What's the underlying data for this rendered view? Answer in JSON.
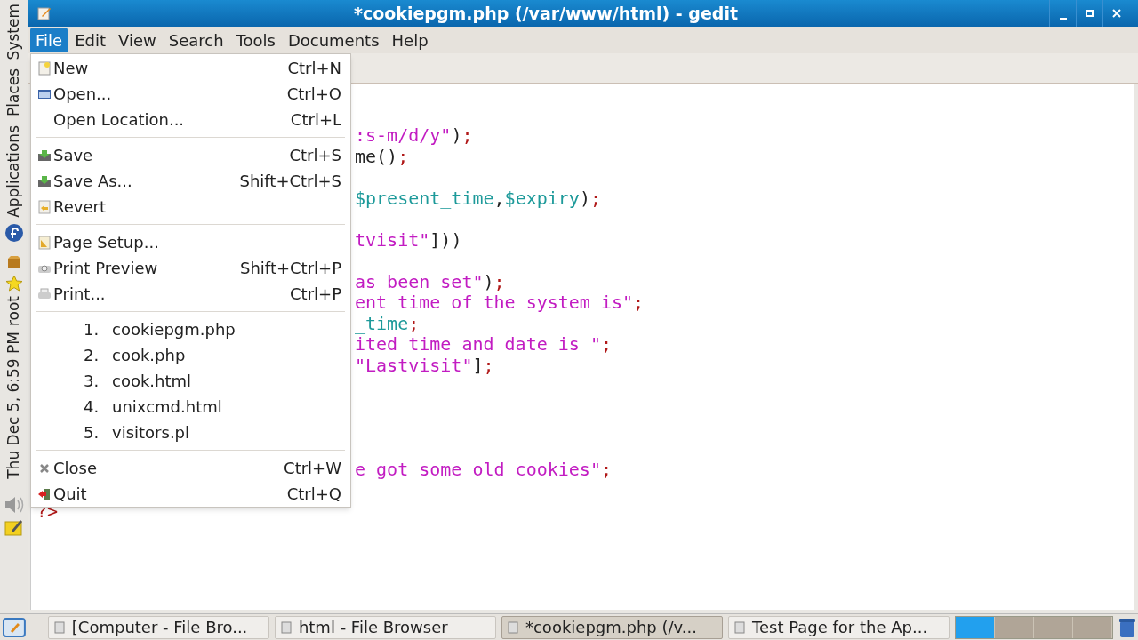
{
  "window": {
    "title": "*cookiepgm.php (/var/www/html) - gedit"
  },
  "side_panel": {
    "menus": [
      "System",
      "Places",
      "Applications"
    ],
    "user": "root",
    "clock": "Thu Dec  5,  6:59 PM"
  },
  "menubar": [
    {
      "label": "File",
      "selected": true
    },
    {
      "label": "Edit",
      "selected": false
    },
    {
      "label": "View",
      "selected": false
    },
    {
      "label": "Search",
      "selected": false
    },
    {
      "label": "Tools",
      "selected": false
    },
    {
      "label": "Documents",
      "selected": false
    },
    {
      "label": "Help",
      "selected": false
    }
  ],
  "file_menu": {
    "sections": [
      [
        {
          "kind": "action",
          "label": "New",
          "shortcut": "Ctrl+N"
        },
        {
          "kind": "action",
          "label": "Open...",
          "shortcut": "Ctrl+O"
        },
        {
          "kind": "action",
          "label": "Open Location...",
          "shortcut": "Ctrl+L"
        }
      ],
      [
        {
          "kind": "action",
          "label": "Save",
          "shortcut": "Ctrl+S"
        },
        {
          "kind": "action",
          "label": "Save As...",
          "shortcut": "Shift+Ctrl+S"
        },
        {
          "kind": "action",
          "label": "Revert"
        }
      ],
      [
        {
          "kind": "action",
          "label": "Page Setup..."
        },
        {
          "kind": "action",
          "label": "Print Preview",
          "shortcut": "Shift+Ctrl+P"
        },
        {
          "kind": "action",
          "label": "Print...",
          "shortcut": "Ctrl+P"
        }
      ],
      [
        {
          "kind": "recent",
          "number": "1.",
          "label": "cookiepgm.php"
        },
        {
          "kind": "recent",
          "number": "2.",
          "label": "cook.php"
        },
        {
          "kind": "recent",
          "number": "3.",
          "label": "cook.html"
        },
        {
          "kind": "recent",
          "number": "4.",
          "label": "unixcmd.html"
        },
        {
          "kind": "recent",
          "number": "5.",
          "label": "visitors.pl"
        }
      ],
      [
        {
          "kind": "action",
          "label": "Close",
          "shortcut": "Ctrl+W"
        },
        {
          "kind": "action",
          "label": "Quit",
          "shortcut": "Ctrl+Q"
        }
      ]
    ]
  },
  "editor": {
    "lines": [
      {
        "segments": [
          {
            "kind": "string",
            "text": ":s-m/d/y\""
          },
          {
            "kind": "plain",
            "text": ")"
          },
          {
            "kind": "punct",
            "text": ";"
          }
        ]
      },
      {
        "segments": [
          {
            "kind": "plain",
            "text": "me()"
          },
          {
            "kind": "punct",
            "text": ";"
          }
        ]
      },
      {
        "segments": [
          {
            "kind": "variable",
            "text": "$present_time"
          },
          {
            "kind": "plain",
            "text": ","
          },
          {
            "kind": "variable",
            "text": "$expiry"
          },
          {
            "kind": "plain",
            "text": ")"
          },
          {
            "kind": "punct",
            "text": ";"
          }
        ]
      },
      {
        "segments": [
          {
            "kind": "string",
            "text": "tvisit\""
          },
          {
            "kind": "plain",
            "text": "]))"
          }
        ]
      },
      {
        "segments": [
          {
            "kind": "string",
            "text": "as been set\""
          },
          {
            "kind": "plain",
            "text": ")"
          },
          {
            "kind": "punct",
            "text": ";"
          }
        ]
      },
      {
        "segments": [
          {
            "kind": "string",
            "text": "ent time of the system is\""
          },
          {
            "kind": "punct",
            "text": ";"
          }
        ]
      },
      {
        "segments": [
          {
            "kind": "variable",
            "text": "_time"
          },
          {
            "kind": "punct",
            "text": ";"
          }
        ]
      },
      {
        "segments": [
          {
            "kind": "string",
            "text": "ited time and date is \""
          },
          {
            "kind": "punct",
            "text": ";"
          }
        ]
      },
      {
        "segments": [
          {
            "kind": "string",
            "text": "\"Lastvisit\""
          },
          {
            "kind": "plain",
            "text": "]"
          },
          {
            "kind": "punct",
            "text": ";"
          }
        ]
      },
      {
        "segments": [
          {
            "kind": "string",
            "text": "e got some old cookies\""
          },
          {
            "kind": "punct",
            "text": ";"
          }
        ]
      },
      {
        "segments": [
          {
            "kind": "punct",
            "text": "?>"
          }
        ]
      }
    ]
  },
  "taskbar": [
    {
      "label": "[Computer - File Bro...",
      "selected": false
    },
    {
      "label": "html - File Browser",
      "selected": false
    },
    {
      "label": "*cookiepgm.php (/v...",
      "selected": true
    },
    {
      "label": "Test Page for the Ap...",
      "selected": false
    }
  ],
  "workspaces": [
    {
      "selected": true
    },
    {
      "selected": false
    },
    {
      "selected": false
    },
    {
      "selected": false
    }
  ]
}
